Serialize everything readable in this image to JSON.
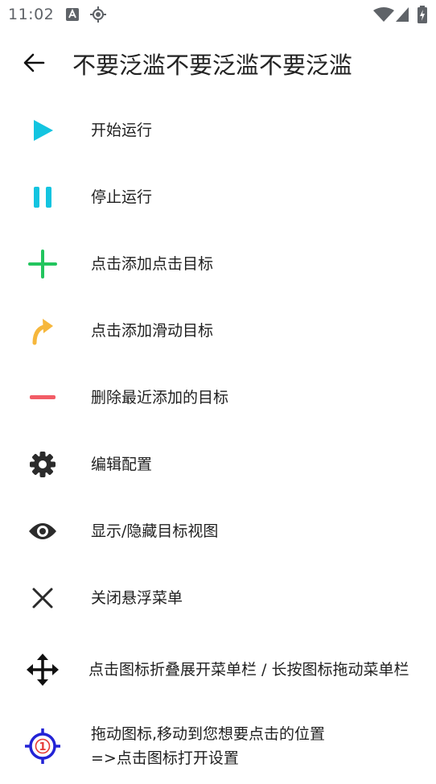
{
  "status_bar": {
    "time": "11:02",
    "icons": [
      "notification-a-icon",
      "location-target-icon",
      "wifi-icon",
      "signal-icon",
      "battery-charging-icon"
    ]
  },
  "app_bar": {
    "back_icon": "arrow-left-icon",
    "title": "不要泛滥不要泛滥不要泛滥"
  },
  "menu": {
    "items": [
      {
        "label": "开始运行",
        "icon": "play-icon",
        "color": "#13c4e0"
      },
      {
        "label": "停止运行",
        "icon": "pause-icon",
        "color": "#13c4e0"
      },
      {
        "label": "点击添加点击目标",
        "icon": "plus-icon",
        "color": "#22c55e"
      },
      {
        "label": "点击添加滑动目标",
        "icon": "swipe-arrow-icon",
        "color": "#f6b73c"
      },
      {
        "label": "删除最近添加的目标",
        "icon": "minus-icon",
        "color": "#f25c66"
      },
      {
        "label": "编辑配置",
        "icon": "gear-icon",
        "color": "#2b2b2b"
      },
      {
        "label": "显示/隐藏目标视图",
        "icon": "eye-icon",
        "color": "#2b2b2b"
      },
      {
        "label": "关闭悬浮菜单",
        "icon": "close-icon",
        "color": "#2b2b2b"
      },
      {
        "label": "点击图标折叠展开菜单栏 / 长按图标拖动菜单栏",
        "icon": "move-icon",
        "color": "#111111"
      },
      {
        "label": "拖动图标,移动到您想要点击的位置\n=>点击图标打开设置",
        "icon": "target-one-icon",
        "color": "#2323d6",
        "badge": "1"
      }
    ]
  }
}
